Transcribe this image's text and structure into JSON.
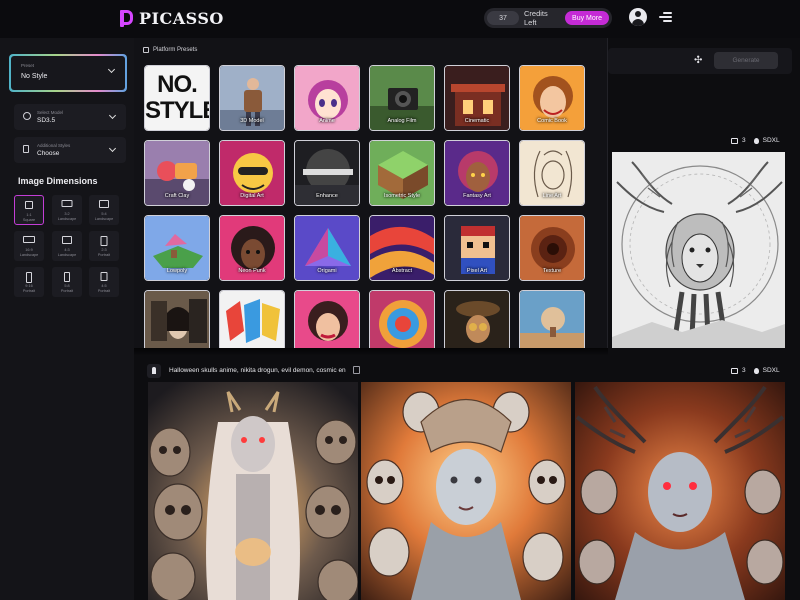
{
  "app": {
    "name": "PICASSO",
    "credits_count": "37",
    "credits_label": "Credits Left",
    "buy_more": "Buy More"
  },
  "sidebar": {
    "preset": {
      "caption": "Preset",
      "value": "No Style"
    },
    "model": {
      "caption": "Select Model",
      "value": "SD3.5"
    },
    "styles": {
      "caption": "Additional Styles",
      "value": "Choose"
    },
    "dimensions_title": "Image Dimensions",
    "dimensions": [
      {
        "ratio": "1:1",
        "name": "Square",
        "active": true
      },
      {
        "ratio": "3:2",
        "name": "Landscape",
        "active": false
      },
      {
        "ratio": "5:4",
        "name": "Landscape",
        "active": false
      },
      {
        "ratio": "16:9",
        "name": "Landscape",
        "active": false
      },
      {
        "ratio": "4:3",
        "name": "Landscape",
        "active": false
      },
      {
        "ratio": "2:3",
        "name": "Portrait",
        "active": false
      },
      {
        "ratio": "9:16",
        "name": "Portrait",
        "active": false
      },
      {
        "ratio": "5:8",
        "name": "Portrait",
        "active": false
      },
      {
        "ratio": "4:5",
        "name": "Portrait",
        "active": false
      }
    ]
  },
  "presets": {
    "title": "Platform Presets",
    "nostyle_art": "NO. STYLE",
    "items": [
      {
        "label": "",
        "id": "no-style"
      },
      {
        "label": "3D Model",
        "id": "3d-model"
      },
      {
        "label": "Anime",
        "id": "anime"
      },
      {
        "label": "Analog Film",
        "id": "analog-film"
      },
      {
        "label": "Cinematic",
        "id": "cinematic"
      },
      {
        "label": "Comic Book",
        "id": "comic-book"
      },
      {
        "label": "Craft Clay",
        "id": "craft-clay"
      },
      {
        "label": "Digital Art",
        "id": "digital-art"
      },
      {
        "label": "Enhance",
        "id": "enhance"
      },
      {
        "label": "Isometric Style",
        "id": "isometric-style"
      },
      {
        "label": "Fantasy Art",
        "id": "fantasy-art"
      },
      {
        "label": "Line Art",
        "id": "line-art"
      },
      {
        "label": "Lowpoly",
        "id": "lowpoly"
      },
      {
        "label": "Neon Punk",
        "id": "neon-punk"
      },
      {
        "label": "Origami",
        "id": "origami"
      },
      {
        "label": "Abstract",
        "id": "abstract"
      },
      {
        "label": "Pixel Art",
        "id": "pixel-art"
      },
      {
        "label": "Texture",
        "id": "texture"
      },
      {
        "label": "",
        "id": "photographic"
      },
      {
        "label": "",
        "id": "graffiti"
      },
      {
        "label": "",
        "id": "pop-art"
      },
      {
        "label": "",
        "id": "kaleidoscope"
      },
      {
        "label": "",
        "id": "steampunk"
      },
      {
        "label": "",
        "id": "surreal"
      }
    ]
  },
  "generate_label": "Generate",
  "lion_meta": {
    "count": "3",
    "model": "SDXL"
  },
  "generation": {
    "prompt": "Halloween skulls anime, nikita drogun, evil demon, cosmic en",
    "count": "3",
    "model": "SDXL"
  }
}
